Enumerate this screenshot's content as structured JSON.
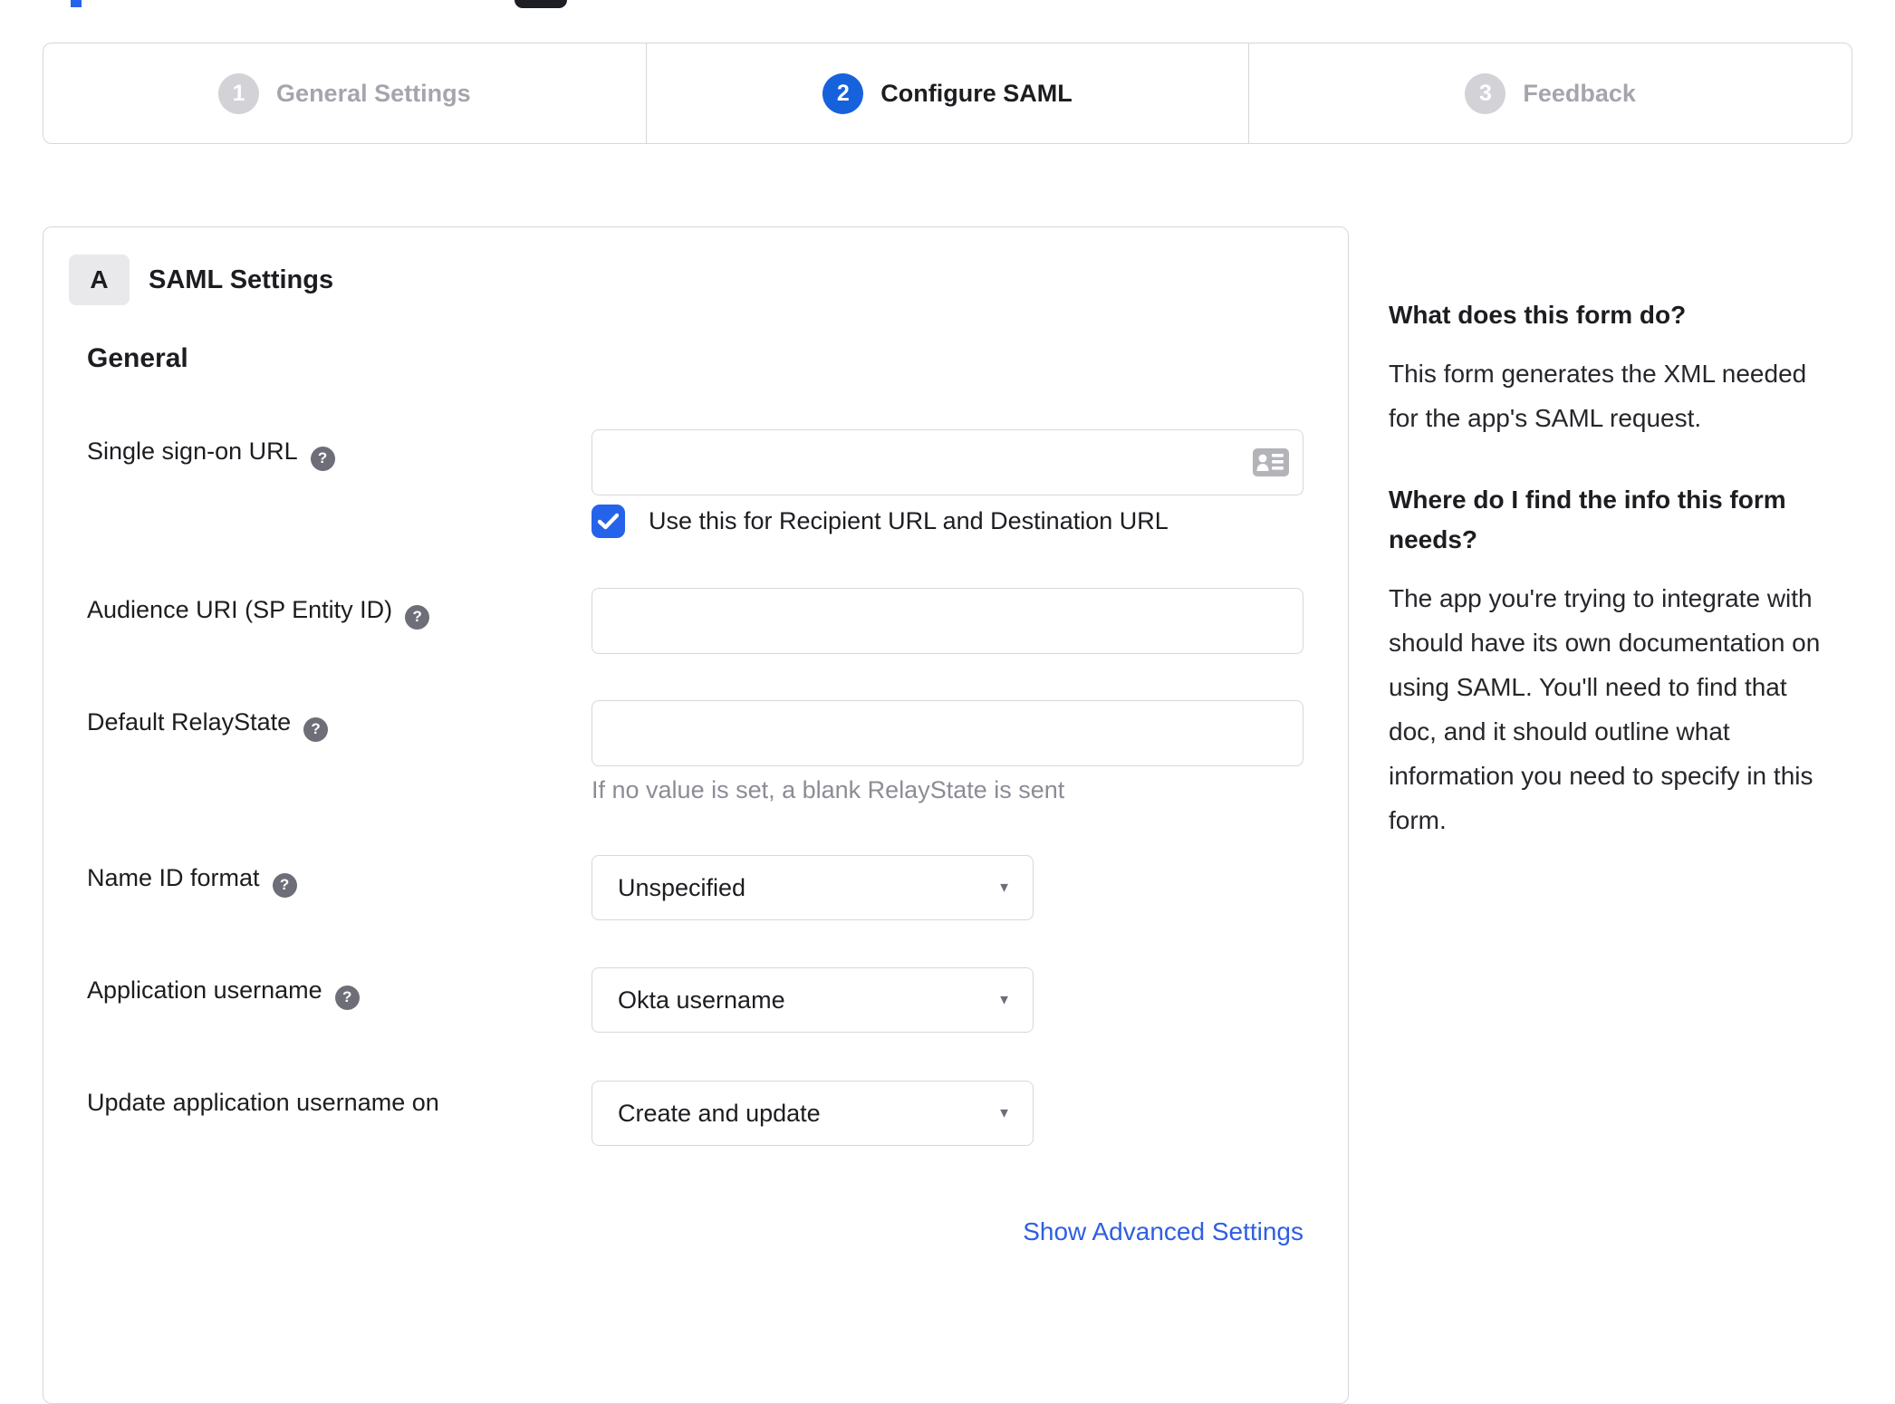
{
  "colors": {
    "accent_blue": "#1662dd",
    "checkbox_blue": "#2563eb",
    "link_blue": "#2e5fe2",
    "border_gray": "#d7d7dc",
    "inactive_step_circle": "#d2d2d7",
    "inactive_step_text": "#a5a5ae",
    "helper_text_gray": "#8c8c96",
    "help_icon_gray": "#6e6e78"
  },
  "stepper": {
    "steps": [
      {
        "number": "1",
        "label": "General Settings",
        "state": "inactive"
      },
      {
        "number": "2",
        "label": "Configure SAML",
        "state": "active"
      },
      {
        "number": "3",
        "label": "Feedback",
        "state": "inactive"
      }
    ]
  },
  "panel": {
    "section_badge": "A",
    "section_title": "SAML Settings",
    "group_title": "General",
    "help_icon_glyph": "?",
    "fields": [
      {
        "label": "Single sign-on URL",
        "type": "text",
        "value": "",
        "has_help": true,
        "trailing_icon": "contact-card-icon",
        "checkbox": {
          "checked": true,
          "label": "Use this for Recipient URL and Destination URL"
        }
      },
      {
        "label": "Audience URI (SP Entity ID)",
        "type": "text",
        "value": "",
        "has_help": true
      },
      {
        "label": "Default RelayState",
        "type": "text",
        "value": "",
        "has_help": true,
        "helper": "If no value is set, a blank RelayState is sent"
      },
      {
        "label": "Name ID format",
        "type": "select",
        "value": "Unspecified",
        "has_help": true
      },
      {
        "label": "Application username",
        "type": "select",
        "value": "Okta username",
        "has_help": true
      },
      {
        "label": "Update application username on",
        "type": "select",
        "value": "Create and update",
        "has_help": false
      }
    ],
    "advanced_settings_link": "Show Advanced Settings"
  },
  "sidebar": {
    "sections": [
      {
        "heading": "What does this form do?",
        "body": "This form generates the XML needed for the app's SAML request."
      },
      {
        "heading": "Where do I find the info this form needs?",
        "body": "The app you're trying to integrate with should have its own documentation on using SAML. You'll need to find that doc, and it should outline what information you need to specify in this form."
      }
    ]
  }
}
